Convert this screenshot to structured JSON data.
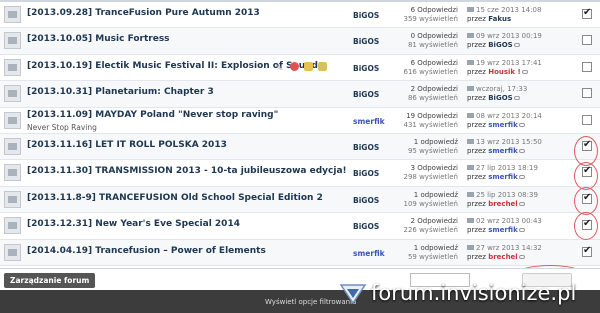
{
  "topics": [
    {
      "title": "[2013.09.28] TranceFusion Pure Autumn 2013",
      "starter": "BiGOS",
      "replies": "6 Odpowiedzi",
      "views": "359 wyświetleń",
      "last_date": "15 cze 2013 14:08",
      "last_by": "Fakus",
      "checked": true
    },
    {
      "title": "[2013.10.05] Music Fortress",
      "starter": "BiGOS",
      "replies": "0 Odpowiedzi",
      "views": "81 wyświetleń",
      "last_date": "09 wrz 2013 00:19",
      "last_by": "BiGOS",
      "checked": false
    },
    {
      "title": "[2013.10.19] Electik Music Festival II: Explosion of Sound",
      "starter": "BiGOS",
      "replies": "6 Odpowiedzi",
      "views": "616 wyświetleń",
      "last_date": "19 wrz 2013 17:41",
      "last_by": "Housik !",
      "checked": false
    },
    {
      "title": "[2013.10.31] Planetarium: Chapter 3",
      "starter": "BiGOS",
      "replies": "2 Odpowiedzi",
      "views": "86 wyświetleń",
      "last_date": "wczoraj, 17:33",
      "last_by": "BiGOS",
      "checked": false
    },
    {
      "title": "[2013.11.09] MAYDAY Poland \"Never stop raving\"",
      "subtitle": "Never Stop Raving",
      "starter": "smerfik",
      "replies": "19 Odpowiedzi",
      "views": "431 wyświetleń",
      "last_date": "08 wrz 2013 20:14",
      "last_by": "smerfik",
      "checked": false
    },
    {
      "title": "[2013.11.16] LET IT ROLL POLSKA 2013",
      "starter": "BiGOS",
      "replies": "1 odpowiedź",
      "views": "95 wyświetleń",
      "last_date": "13 wrz 2013 15:50",
      "last_by": "smerfik",
      "checked": true
    },
    {
      "title": "[2013.11.30] TRANSMISSION 2013 - 10-ta jubileuszowa edycja!",
      "starter": "BiGOS",
      "replies": "3 Odpowiedzi",
      "views": "298 wyświetleń",
      "last_date": "27 lip 2013 18:19",
      "last_by": "smerfik",
      "checked": true
    },
    {
      "title": "[2013.11.8-9] TRANCEFUSION Old School Special Edition 2",
      "starter": "BiGOS",
      "replies": "1 odpowiedź",
      "views": "109 wyświetleń",
      "last_date": "25 lip 2013 08:39",
      "last_by": "brechel",
      "checked": true
    },
    {
      "title": "[2013.12.31] New Year's Eve Special 2014",
      "starter": "BiGOS",
      "replies": "2 Odpowiedzi",
      "views": "226 wyświetleń",
      "last_date": "02 wrz 2013 00:43",
      "last_by": "smerfik",
      "checked": true
    },
    {
      "title": "[2014.04.19] Trancefusion – Power of Elements",
      "starter": "smerfik",
      "replies": "1 odpowiedź",
      "views": "59 wyświetleń",
      "last_date": "27 wrz 2013 14:32",
      "last_by": "brechel",
      "checked": true
    }
  ],
  "by_prefix": "przez",
  "controls": {
    "manage_button": "Zarządzanie forum",
    "filter_link": "Wyświetl opcje filtrowania"
  },
  "watermark": "forum.invisionize.pl",
  "colors": {
    "accent": "#1d3652",
    "red_user": "#c8323c",
    "blue_user": "#3a55b4",
    "annotation": "#e0585c"
  }
}
